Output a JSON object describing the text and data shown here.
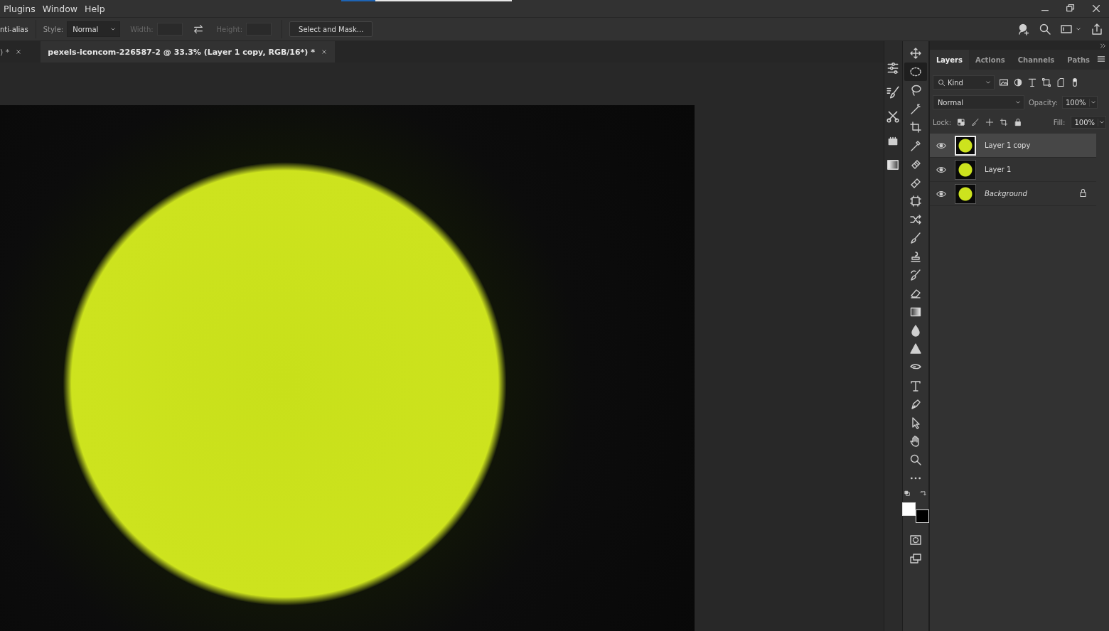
{
  "menu": [
    "Plugins",
    "Window",
    "Help"
  ],
  "progress": {
    "level": 0.2
  },
  "options_bar": {
    "antialias_label": "nti-alias",
    "style_label": "Style:",
    "style_value": "Normal",
    "width_label": "Width:",
    "height_label": "Height:",
    "size_disabled": true,
    "select_mask_button": "Select and Mask..."
  },
  "document_tabs": [
    {
      "label": ") *",
      "selected": false
    },
    {
      "label": "pexels-iconcom-226587-2 @ 33.3% (Layer 1 copy, RGB/16*) *",
      "selected": true
    }
  ],
  "tools": [
    {
      "kind": "move",
      "selected": false
    },
    {
      "kind": "ellipse",
      "selected": true
    },
    {
      "kind": "lasso",
      "selected": false
    },
    {
      "kind": "wand",
      "selected": false
    },
    {
      "kind": "crop",
      "selected": false
    },
    {
      "kind": "eyedropper",
      "selected": false
    },
    {
      "kind": "heal",
      "selected": false
    },
    {
      "kind": "bandage",
      "selected": false
    },
    {
      "kind": "frame",
      "selected": false
    },
    {
      "kind": "shuffle",
      "selected": false
    },
    {
      "kind": "brush",
      "selected": false
    },
    {
      "kind": "stamp",
      "selected": false
    },
    {
      "kind": "historybrush",
      "selected": false
    },
    {
      "kind": "eraser",
      "selected": false
    },
    {
      "kind": "gradient",
      "selected": false
    },
    {
      "kind": "drop",
      "selected": false
    },
    {
      "kind": "triangle",
      "selected": false
    },
    {
      "kind": "smudge",
      "selected": false
    },
    {
      "kind": "type",
      "selected": false
    },
    {
      "kind": "pen",
      "selected": false
    },
    {
      "kind": "arrow",
      "selected": false
    },
    {
      "kind": "hand",
      "selected": false
    },
    {
      "kind": "zoom",
      "selected": false
    },
    {
      "kind": "more",
      "selected": false
    }
  ],
  "color_swatches": [
    {
      "kind": "foreground",
      "color": "#ffffff"
    },
    {
      "kind": "background",
      "color": "#000000"
    }
  ],
  "layers_panel": {
    "tabs": [
      {
        "label": "Layers",
        "selected": true
      },
      {
        "label": "Actions",
        "selected": false
      },
      {
        "label": "Channels",
        "selected": false
      },
      {
        "label": "Paths",
        "selected": false
      }
    ],
    "filter_value": "Kind",
    "blend_mode": "Normal",
    "opacity_label": "Opacity:",
    "opacity_value": "100%",
    "lock_label": "Lock:",
    "fill_label": "Fill:",
    "fill_value": "100%",
    "layers": [
      {
        "name": "Layer 1 copy",
        "selected": true,
        "visible": true,
        "kind": "layer",
        "locked": false
      },
      {
        "name": "Layer 1",
        "selected": false,
        "visible": true,
        "kind": "layer",
        "locked": false
      },
      {
        "name": "Background",
        "selected": false,
        "visible": true,
        "kind": "background",
        "locked": true
      }
    ]
  }
}
